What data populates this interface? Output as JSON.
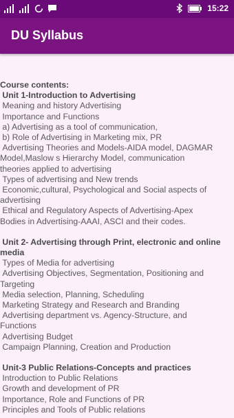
{
  "status_bar": {
    "time": "15:22",
    "left_icons": [
      "sim-signal-icon",
      "sim-signal-icon",
      "sync-icon",
      "chat-icon"
    ],
    "right_icons": [
      "bluetooth-icon",
      "battery-icon"
    ]
  },
  "app_bar": {
    "title": "DU Syllabus"
  },
  "content": {
    "intro": "Course contents:",
    "sections": [
      {
        "heading": " Unit 1-Introduction to Advertising",
        "lines": [
          " Meaning and history Advertising",
          " Importance and Functions",
          " a) Advertising as a tool of communication,",
          " b) Role of Advertising in Marketing mix, PR",
          " Advertising Theories and Models-AIDA model, DAGMAR",
          "Model,Maslow s Hierarchy Model, communication",
          "theories applied to advertising",
          " Types of advertising and New trends",
          " Economic,cultural, Psychological and Social aspects of",
          "advertising",
          " Ethical and Regulatory Aspects of Advertising-Apex",
          "Bodies in Advertising-AAAI, ASCI and their codes."
        ]
      },
      {
        "heading": " Unit 2- Advertising through Print, electronic and online",
        "heading2": "media",
        "lines": [
          " Types of Media for advertising",
          " Advertising Objectives, Segmentation, Positioning and",
          "Targeting",
          " Media selection, Planning, Scheduling",
          " Marketing Strategy and Research and Branding",
          " Advertising department vs. Agency-Structure, and",
          "Functions",
          " Advertising Budget",
          " Campaign Planning, Creation and Production"
        ]
      },
      {
        "heading": " Unit-3 Public Relations-Concepts and practices",
        "lines": [
          " Introduction to Public Relations",
          " Growth and development of PR",
          " Importance, Role and Functions of PR",
          " Principles and Tools of Public relations"
        ]
      }
    ]
  }
}
